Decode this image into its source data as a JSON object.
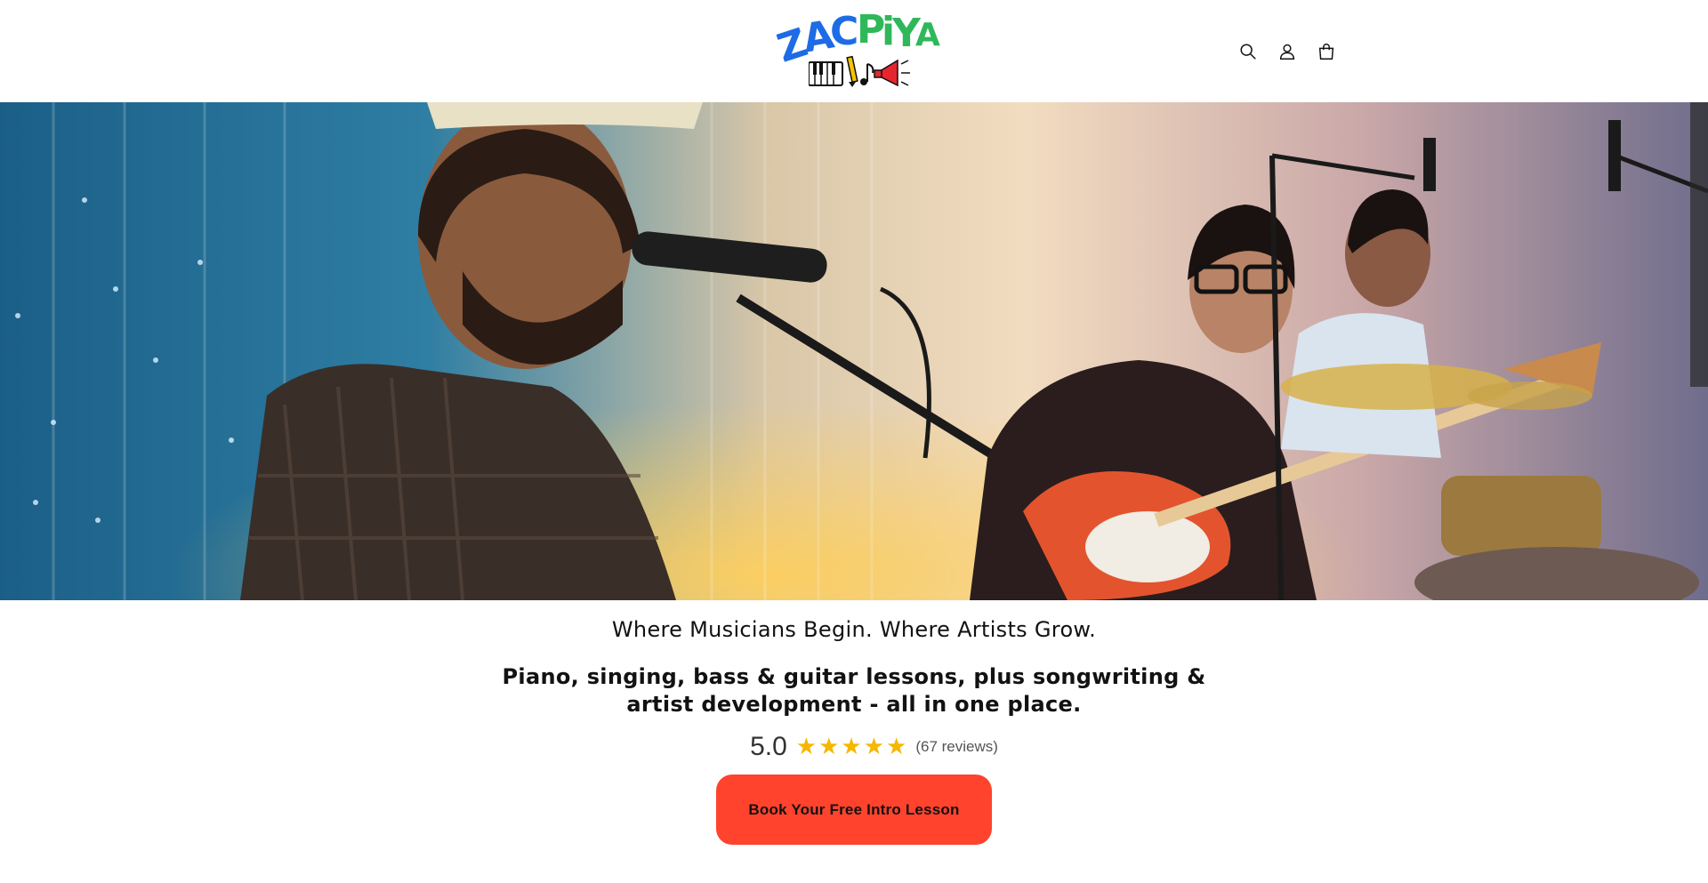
{
  "header": {
    "logo_text": "ZACPIYA",
    "icons": [
      "search-icon",
      "account-icon",
      "cart-icon"
    ]
  },
  "hero": {
    "image_description_icon": "band-performance-photo"
  },
  "main": {
    "tagline": "Where Musicians Begin. Where Artists Grow.",
    "subhead": "Piano, singing, bass & guitar lessons, plus songwriting & artist development - all in one place.",
    "rating": {
      "score": "5.0",
      "stars": 5,
      "reviews": "(67 reviews)"
    },
    "cta_label": "Book Your Free Intro Lesson"
  },
  "colors": {
    "cta": "#ff432d",
    "star": "#f6b700",
    "logo_blue": "#1e6be6",
    "logo_green": "#2fb85a"
  }
}
